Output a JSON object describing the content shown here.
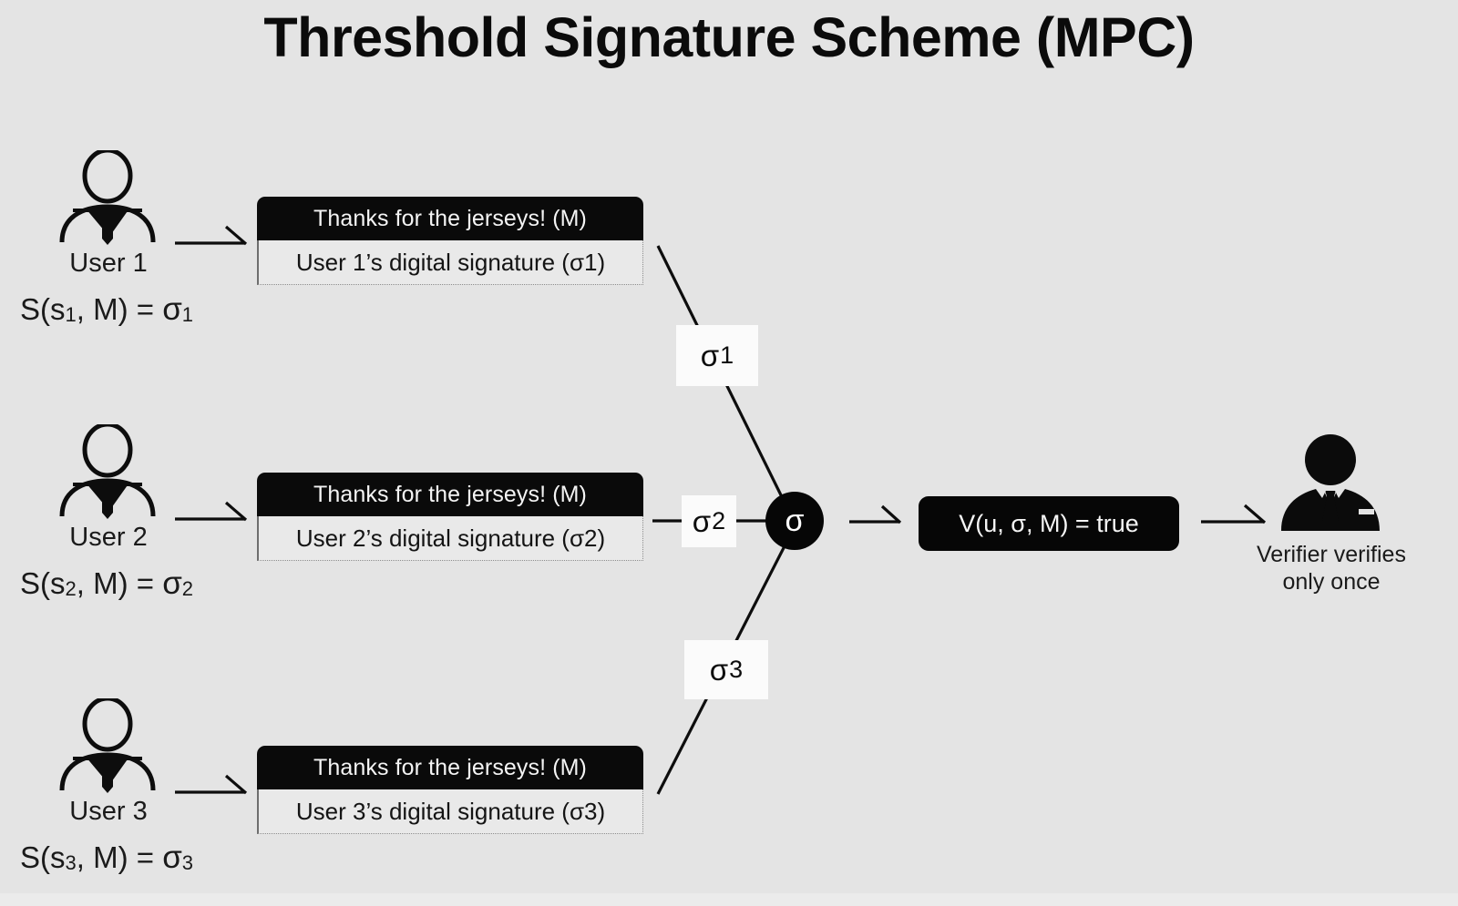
{
  "slide": {
    "title": "Threshold Signature Scheme (MPC)",
    "background_color": "#e4e4e4",
    "accent_color": "#0a0a0a"
  },
  "users": [
    {
      "icon": "user-outline-icon",
      "name": "User 1",
      "formula_fn": "S(s",
      "formula_index": "1",
      "formula_mid": ", M)  =  ",
      "formula_sigma": "σ",
      "formula_sigma_index": "1",
      "card": {
        "message": "Thanks for the jerseys! (M)",
        "signature": "User 1’s digital signature (σ1)"
      },
      "edge_label_sigma": "σ",
      "edge_label_index": "1"
    },
    {
      "icon": "user-outline-icon",
      "name": "User 2",
      "formula_fn": "S(s",
      "formula_index": "2",
      "formula_mid": ", M)  =  ",
      "formula_sigma": "σ",
      "formula_sigma_index": "2",
      "card": {
        "message": "Thanks for the jerseys! (M)",
        "signature": "User 2’s digital signature (σ2)"
      },
      "edge_label_sigma": "σ",
      "edge_label_index": "2"
    },
    {
      "icon": "user-outline-icon",
      "name": "User 3",
      "formula_fn": "S(s",
      "formula_index": "3",
      "formula_mid": ", M)  =  ",
      "formula_sigma": "σ",
      "formula_sigma_index": "3",
      "card": {
        "message": "Thanks for the jerseys! (M)",
        "signature": "User 3’s digital signature (σ3)"
      },
      "edge_label_sigma": "σ",
      "edge_label_index": "3"
    }
  ],
  "aggregator": {
    "label": "σ"
  },
  "verification": {
    "expression": "V(u, σ, M)  =  true"
  },
  "verifier": {
    "icon": "verifier-person-icon",
    "caption_line1": "Verifier verifies",
    "caption_line2": "only once"
  }
}
